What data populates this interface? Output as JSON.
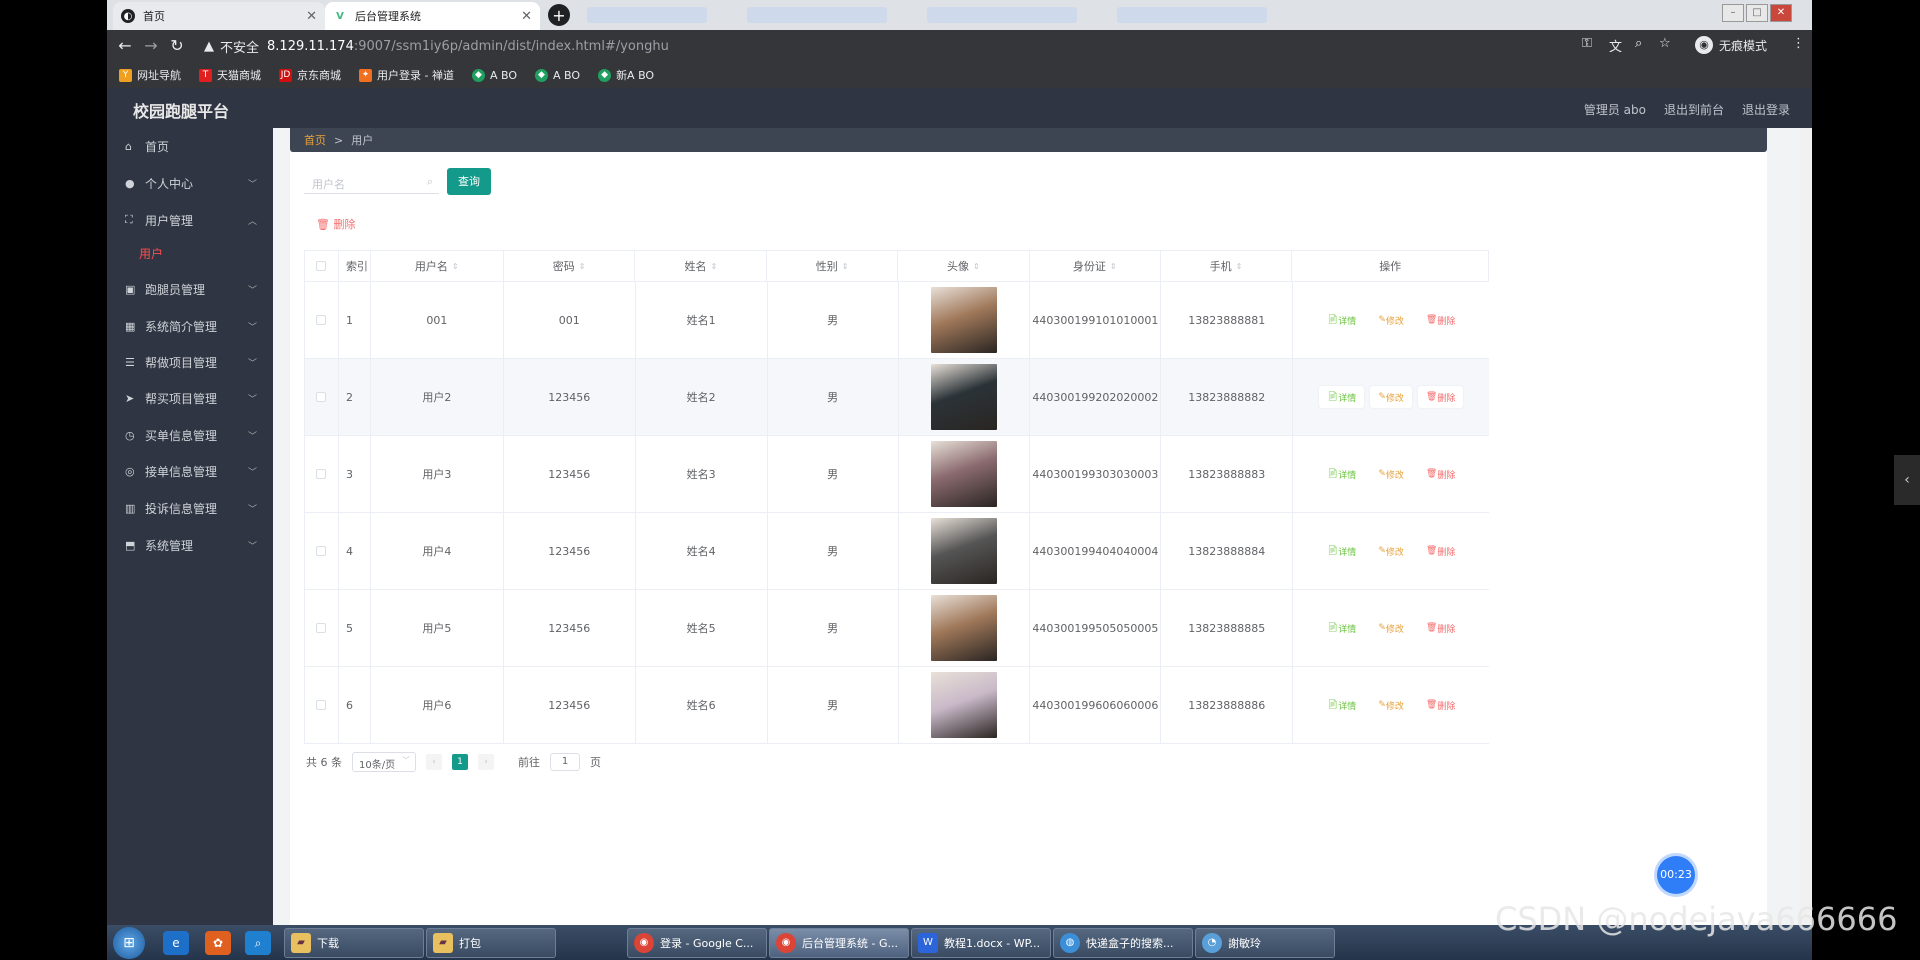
{
  "browser": {
    "tabs": [
      {
        "title": "首页",
        "active": false
      },
      {
        "title": "后台管理系统",
        "active": true
      }
    ],
    "url": {
      "insecure_label": "不安全",
      "host": "8.129.11.174",
      "rest": ":9007/ssm1iy6p/admin/dist/index.html#/yonghu"
    },
    "incognito_label": "无痕模式",
    "bookmarks": [
      "网址导航",
      "天猫商城",
      "京东商城",
      "用户登录 - 禅道",
      "A BO",
      "A BO",
      "新A BO"
    ]
  },
  "header": {
    "brand": "校园跑腿平台",
    "admin": "管理员 abo",
    "to_front": "退出到前台",
    "logout": "退出登录"
  },
  "sidebar": {
    "items": [
      {
        "label": "首页",
        "icon": "home-icon"
      },
      {
        "label": "个人中心",
        "icon": "user-icon"
      },
      {
        "label": "用户管理",
        "icon": "expand-icon"
      },
      {
        "label": "跑腿员管理",
        "icon": "clipboard-icon"
      },
      {
        "label": "系统简介管理",
        "icon": "grid-icon"
      },
      {
        "label": "帮做项目管理",
        "icon": "sliders-icon"
      },
      {
        "label": "帮买项目管理",
        "icon": "send-icon"
      },
      {
        "label": "买单信息管理",
        "icon": "clock-icon"
      },
      {
        "label": "接单信息管理",
        "icon": "globe-icon"
      },
      {
        "label": "投诉信息管理",
        "icon": "columns-icon"
      },
      {
        "label": "系统管理",
        "icon": "box-icon"
      }
    ],
    "active_sub": "用户"
  },
  "breadcrumb": {
    "home": "首页",
    "sep": ">",
    "current": "用户"
  },
  "search": {
    "placeholder": "用户名",
    "button": "查询"
  },
  "delete_button": "删除",
  "table": {
    "headers": [
      "索引",
      "用户名",
      "密码",
      "姓名",
      "性别",
      "头像",
      "身份证",
      "手机",
      "操作"
    ],
    "rows": [
      {
        "index": "1",
        "username": "001",
        "password": "001",
        "name": "姓名1",
        "gender": "男",
        "avatar_color": "#a0785a",
        "id_card": "440300199101010001",
        "phone": "13823888881"
      },
      {
        "index": "2",
        "username": "用户2",
        "password": "123456",
        "name": "姓名2",
        "gender": "男",
        "avatar_color": "#2b3338",
        "id_card": "440300199202020002",
        "phone": "13823888882"
      },
      {
        "index": "3",
        "username": "用户3",
        "password": "123456",
        "name": "姓名3",
        "gender": "男",
        "avatar_color": "#8a6a6f",
        "id_card": "440300199303030003",
        "phone": "13823888883"
      },
      {
        "index": "4",
        "username": "用户4",
        "password": "123456",
        "name": "姓名4",
        "gender": "男",
        "avatar_color": "#555555",
        "id_card": "440300199404040004",
        "phone": "13823888884"
      },
      {
        "index": "5",
        "username": "用户5",
        "password": "123456",
        "name": "姓名5",
        "gender": "男",
        "avatar_color": "#a0785a",
        "id_card": "440300199505050005",
        "phone": "13823888885"
      },
      {
        "index": "6",
        "username": "用户6",
        "password": "123456",
        "name": "姓名6",
        "gender": "男",
        "avatar_color": "#c9b9c8",
        "id_card": "440300199606060006",
        "phone": "13823888886"
      }
    ],
    "actions": {
      "detail": "详情",
      "edit": "修改",
      "delete": "删除"
    }
  },
  "pagination": {
    "total": "共 6 条",
    "page_size": "10条/页",
    "current": "1",
    "goto": "前往",
    "goto_value": "1",
    "page_unit": "页"
  },
  "timer": "00:23",
  "taskbar": {
    "items": [
      "下载",
      "打包",
      "登录 - Google C...",
      "后台管理系统 - G...",
      "教程1.docx - WP...",
      "快递盒子的搜索...",
      "謝敏玲"
    ]
  },
  "watermark": "CSDN @nodejava666666",
  "colors": {
    "accent": "#139a8a",
    "danger": "#f56c6c",
    "warning": "#e6a23c",
    "success": "#67c23a",
    "sidebar": "#2f3542"
  }
}
